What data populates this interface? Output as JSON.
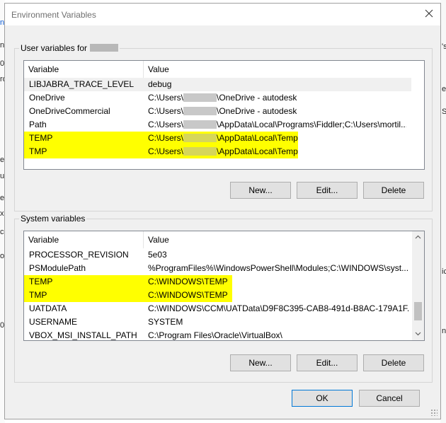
{
  "window": {
    "title": "Environment Variables"
  },
  "user_group": {
    "label_prefix": "User variables for",
    "columns": {
      "variable": "Variable",
      "value": "Value"
    },
    "rows": [
      {
        "variable": "LIBJABRA_TRACE_LEVEL",
        "value_pre": "debug",
        "value_post": "",
        "highlight": false
      },
      {
        "variable": "OneDrive",
        "value_pre": "C:\\Users\\",
        "value_post": "\\OneDrive - autodesk",
        "highlight": false
      },
      {
        "variable": "OneDriveCommercial",
        "value_pre": "C:\\Users\\",
        "value_post": "\\OneDrive - autodesk",
        "highlight": false
      },
      {
        "variable": "Path",
        "value_pre": "C:\\Users\\",
        "value_post": "\\AppData\\Local\\Programs\\Fiddler;C:\\Users\\mortil...",
        "highlight": false
      },
      {
        "variable": "TEMP",
        "value_pre": "C:\\Users\\",
        "value_post": "\\AppData\\Local\\Temp",
        "highlight": true
      },
      {
        "variable": "TMP",
        "value_pre": "C:\\Users\\",
        "value_post": "\\AppData\\Local\\Temp",
        "highlight": true
      }
    ],
    "buttons": {
      "new": "New...",
      "edit": "Edit...",
      "delete": "Delete"
    }
  },
  "system_group": {
    "label": "System variables",
    "columns": {
      "variable": "Variable",
      "value": "Value"
    },
    "rows": [
      {
        "variable": "PROCESSOR_REVISION",
        "value": "5e03",
        "highlight": false
      },
      {
        "variable": "PSModulePath",
        "value": "%ProgramFiles%\\WindowsPowerShell\\Modules;C:\\WINDOWS\\syst...",
        "highlight": false
      },
      {
        "variable": "TEMP",
        "value": "C:\\WINDOWS\\TEMP",
        "highlight": true
      },
      {
        "variable": "TMP",
        "value": "C:\\WINDOWS\\TEMP",
        "highlight": true
      },
      {
        "variable": "UATDATA",
        "value": "C:\\WINDOWS\\CCM\\UATData\\D9F8C395-CAB8-491d-B8AC-179A1F...",
        "highlight": false
      },
      {
        "variable": "USERNAME",
        "value": "SYSTEM",
        "highlight": false
      },
      {
        "variable": "VBOX_MSI_INSTALL_PATH",
        "value": "C:\\Program Files\\Oracle\\VirtualBox\\",
        "highlight": false
      }
    ],
    "buttons": {
      "new": "New...",
      "edit": "Edit...",
      "delete": "Delete"
    }
  },
  "footer": {
    "ok": "OK",
    "cancel": "Cancel"
  },
  "background_fragments": [
    "n",
    "n",
    "0",
    "ro",
    "e:",
    "uc",
    "e,",
    "x",
    "ce",
    "o",
    "0",
    "'s",
    "e",
    "S",
    "ic",
    "n"
  ],
  "colors": {
    "highlight": "#ffff00",
    "dialog_bg": "#f0f0f0",
    "default_button_border": "#0078d7"
  },
  "icons": {
    "close": "close-icon",
    "scroll_up": "chevron-up-icon",
    "scroll_down": "chevron-down-icon"
  }
}
